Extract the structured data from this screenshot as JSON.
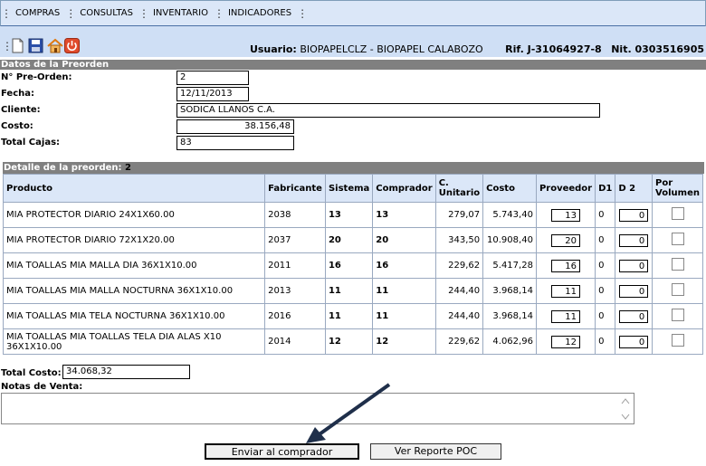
{
  "menu": {
    "items": [
      {
        "label": "COMPRAS"
      },
      {
        "label": "CONSULTAS"
      },
      {
        "label": "INVENTARIO"
      },
      {
        "label": "INDICADORES"
      }
    ]
  },
  "toolbar": {
    "icons": [
      "new-document-icon",
      "save-icon",
      "home-icon",
      "power-icon"
    ],
    "user_label": "Usuario:",
    "user_value": "BIOPAPELCLZ - BIOPAPEL CALABOZO",
    "rif": "Rif. J-31064927-8",
    "nit": "Nit. 0303516905"
  },
  "preorden": {
    "header": "Datos de la Preorden",
    "numero_label": "N° Pre-Orden:",
    "numero": "2",
    "fecha_label": "Fecha:",
    "fecha": "12/11/2013",
    "cliente_label": "Cliente:",
    "cliente": "SODICA LLANOS C.A.",
    "costo_label": "Costo:",
    "costo": "38.156,48",
    "cajas_label": "Total Cajas:",
    "cajas": "83"
  },
  "detalle": {
    "header": "Detalle de la preorden:",
    "header_num": "2",
    "columns": {
      "producto": "Producto",
      "fabricante": "Fabricante",
      "sistema": "Sistema",
      "comprador": "Comprador",
      "c_unitario": "C. Unitario",
      "costo": "Costo",
      "proveedor": "Proveedor",
      "d1": "D1",
      "d2": "D 2",
      "por_volumen": "Por Volumen"
    },
    "rows": [
      {
        "producto": "MIA PROTECTOR DIARIO 24X1X60.00",
        "fabricante": "2038",
        "sistema": "13",
        "comprador": "13",
        "c_unitario": "279,07",
        "costo": "5.743,40",
        "proveedor": "13",
        "d1": "0",
        "d2": "0"
      },
      {
        "producto": "MIA PROTECTOR DIARIO 72X1X20.00",
        "fabricante": "2037",
        "sistema": "20",
        "comprador": "20",
        "c_unitario": "343,50",
        "costo": "10.908,40",
        "proveedor": "20",
        "d1": "0",
        "d2": "0"
      },
      {
        "producto": "MIA TOALLAS MIA MALLA DIA 36X1X10.00",
        "fabricante": "2011",
        "sistema": "16",
        "comprador": "16",
        "c_unitario": "229,62",
        "costo": "5.417,28",
        "proveedor": "16",
        "d1": "0",
        "d2": "0"
      },
      {
        "producto": "MIA TOALLAS MIA MALLA NOCTURNA 36X1X10.00",
        "fabricante": "2013",
        "sistema": "11",
        "comprador": "11",
        "c_unitario": "244,40",
        "costo": "3.968,14",
        "proveedor": "11",
        "d1": "0",
        "d2": "0"
      },
      {
        "producto": "MIA TOALLAS MIA TELA NOCTURNA 36X1X10.00",
        "fabricante": "2016",
        "sistema": "11",
        "comprador": "11",
        "c_unitario": "244,40",
        "costo": "3.968,14",
        "proveedor": "11",
        "d1": "0",
        "d2": "0"
      },
      {
        "producto": "MIA TOALLAS MIA TOALLAS TELA DIA ALAS X10 36X1X10.00",
        "fabricante": "2014",
        "sistema": "12",
        "comprador": "12",
        "c_unitario": "229,62",
        "costo": "4.062,96",
        "proveedor": "12",
        "d1": "0",
        "d2": "0"
      }
    ]
  },
  "totales": {
    "total_costo_label": "Total Costo:",
    "total_costo": "34.068,32",
    "notas_label": "Notas de Venta:",
    "notas": ""
  },
  "buttons": {
    "enviar": "Enviar al comprador",
    "reporte": "Ver Reporte POC"
  }
}
